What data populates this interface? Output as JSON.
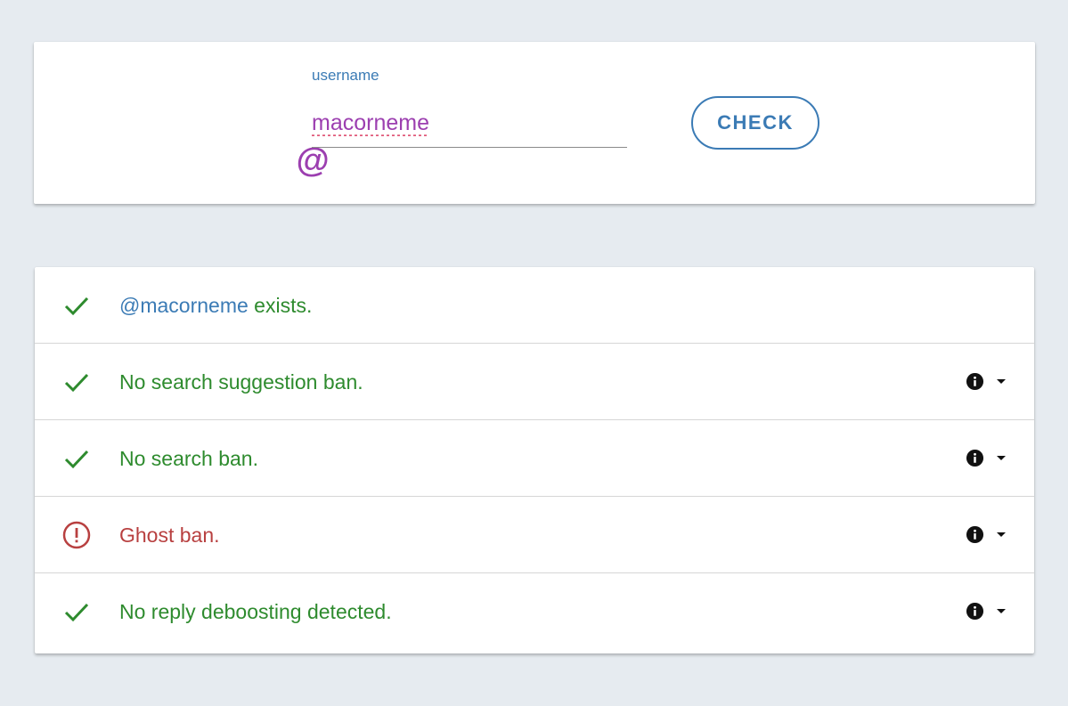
{
  "search": {
    "at_symbol": "@",
    "label": "username",
    "value": "macorneme",
    "button_label": "CHECK"
  },
  "results": [
    {
      "status": "ok",
      "handle": "@macorneme",
      "text": " exists.",
      "has_info": false
    },
    {
      "status": "ok",
      "handle": "",
      "text": "No search suggestion ban.",
      "has_info": true
    },
    {
      "status": "ok",
      "handle": "",
      "text": "No search ban.",
      "has_info": true
    },
    {
      "status": "bad",
      "handle": "",
      "text": "Ghost ban.",
      "has_info": true
    },
    {
      "status": "ok",
      "handle": "",
      "text": "No reply deboosting detected.",
      "has_info": true
    }
  ],
  "colors": {
    "ok": "#2e8b2e",
    "bad": "#b84040",
    "accent": "#3b7bb5",
    "username": "#9c3fb0"
  },
  "icons": {
    "ok": "check-icon",
    "bad": "alert-circle-icon",
    "info": "info-icon",
    "expand": "caret-down-icon"
  }
}
